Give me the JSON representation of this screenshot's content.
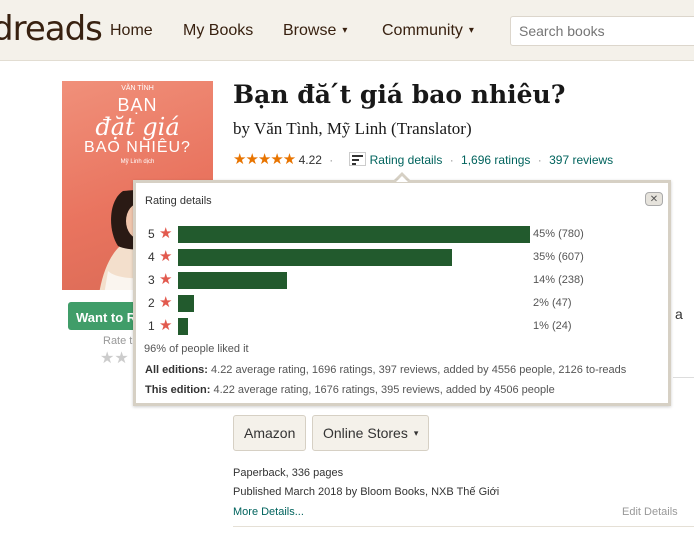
{
  "nav": {
    "logo": "dreads",
    "items": [
      {
        "label": "Home"
      },
      {
        "label": "My Books"
      },
      {
        "label": "Browse",
        "caret": "▾"
      },
      {
        "label": "Community",
        "caret": "▾"
      }
    ],
    "search_placeholder": "Search books"
  },
  "book": {
    "cover_text": {
      "top": "VĂN TÌNH",
      "line1": "BẠN",
      "line2": "đặt giá",
      "line3": "BAO NHIÊU?",
      "sub": "Mỹ Linh dịch"
    },
    "title": "Bạn đă ́t giá bao nhiêu?",
    "authors": "by Văn Tình, Mỹ Linh (Translator)",
    "avg_rating": "4.22",
    "stars": "★★★★★",
    "rating_details_link": "Rating details",
    "ratings_link": "1,696 ratings",
    "reviews_link": "397 reviews",
    "want_to_read": "Want to R",
    "rate_this": "Rate t",
    "rate_stars": "★★"
  },
  "popup": {
    "title": "Rating details",
    "close": "✕",
    "rows": [
      {
        "label": "5",
        "fraction": 0.45,
        "pct": "45% (780)"
      },
      {
        "label": "4",
        "fraction": 0.35,
        "pct": "35% (607)"
      },
      {
        "label": "3",
        "fraction": 0.14,
        "pct": "14% (238)"
      },
      {
        "label": "2",
        "fraction": 0.02,
        "pct": "2% (47)"
      },
      {
        "label": "1",
        "fraction": 0.01,
        "pct": "1% (24)"
      }
    ],
    "liked": "96% of people liked it",
    "all_editions": {
      "label": "All editions:",
      "text": "4.22 average rating, 1696 ratings, 397 reviews, added by 4556 people, 2126 to-reads"
    },
    "this_edition": {
      "label": "This edition:",
      "text": "4.22 average rating, 1676 ratings, 395 reviews, added by 4506 people"
    }
  },
  "behind": {
    "frag": "a"
  },
  "buy": {
    "amazon": "Amazon",
    "online_stores": "Online Stores",
    "caret": "▾"
  },
  "details": {
    "format": "Paperback, 336 pages",
    "published": "Published March 2018 by Bloom Books, NXB Thế Giới",
    "more": "More Details...",
    "edit": "Edit Details"
  },
  "colors": {
    "bar": "#225a2d",
    "star": "#e25a4e",
    "link": "#00635d",
    "nav_bg": "#f4f1ea"
  }
}
